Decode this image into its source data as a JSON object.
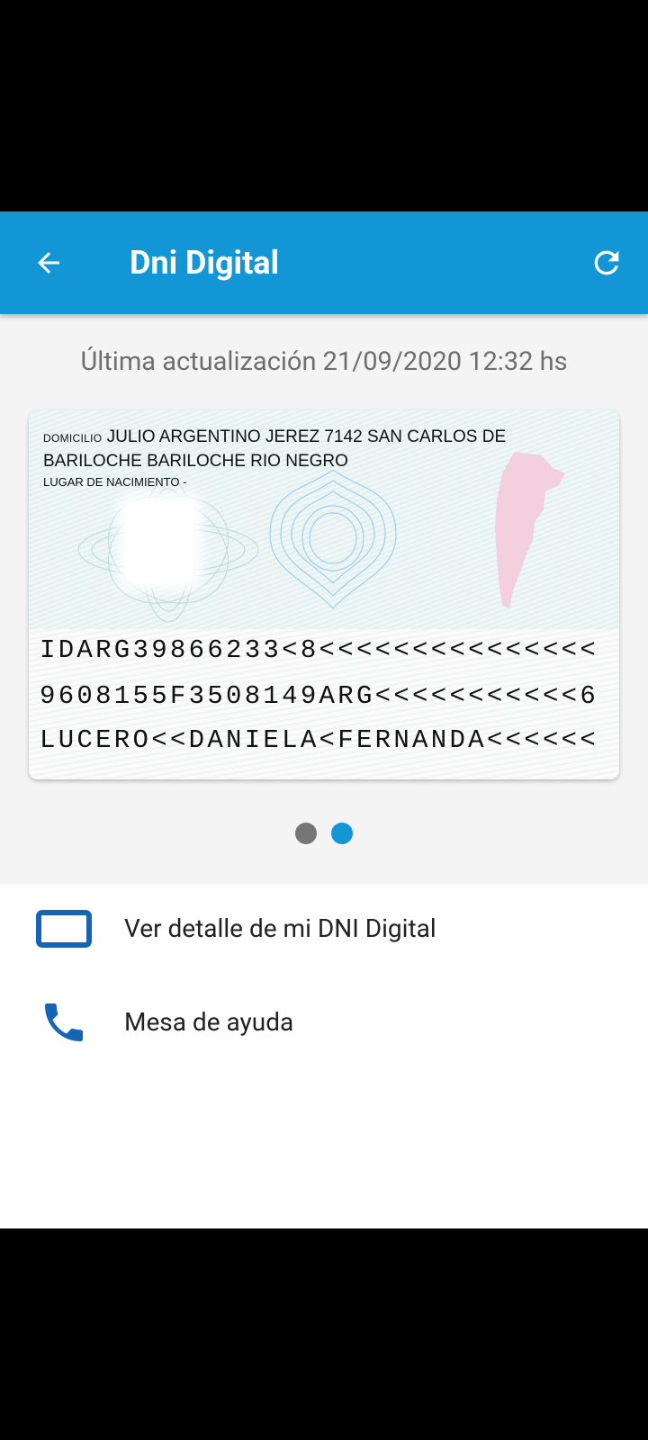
{
  "app_bar": {
    "title": "Dni Digital",
    "back_icon": "arrow-left-icon",
    "refresh_icon": "refresh-icon",
    "color": "#1296d6"
  },
  "last_update": "Última actualización 21/09/2020 12:32 hs",
  "card": {
    "domicilio_label": "DOMICILIO",
    "domicilio_value": "JULIO ARGENTINO JEREZ 7142   SAN CARLOS DE BARILOCHE  BARILOCHE RIO NEGRO",
    "nacimiento_label": "LUGAR DE NACIMIENTO",
    "nacimiento_value": "-",
    "mrz_lines": [
      "IDARG39866233<8<<<<<<<<<<<<<<<",
      "9608155F3508149ARG<<<<<<<<<<<6",
      "LUCERO<<DANIELA<FERNANDA<<<<<<"
    ]
  },
  "pager": {
    "dots": [
      {
        "active": false,
        "color": "#757575"
      },
      {
        "active": true,
        "color": "#1296d6"
      }
    ]
  },
  "menu": {
    "items": [
      {
        "label": "Ver detalle de mi DNI Digital",
        "icon": "id-card-icon"
      },
      {
        "label": "Mesa de ayuda",
        "icon": "phone-icon"
      }
    ],
    "icon_color": "#1565b4"
  }
}
